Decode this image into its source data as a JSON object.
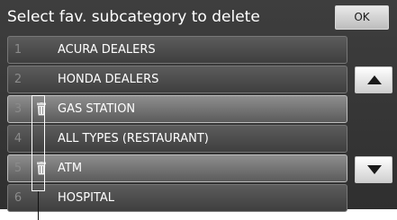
{
  "header": {
    "title": "Select fav. subcategory to delete",
    "ok_label": "OK"
  },
  "list": {
    "items": [
      {
        "number": "1",
        "label": "ACURA DEALERS",
        "selected": false,
        "trash_icon": false
      },
      {
        "number": "2",
        "label": "HONDA DEALERS",
        "selected": false,
        "trash_icon": false
      },
      {
        "number": "3",
        "label": "GAS STATION",
        "selected": true,
        "trash_icon": true
      },
      {
        "number": "4",
        "label": "ALL TYPES (RESTAURANT)",
        "selected": false,
        "trash_icon": false
      },
      {
        "number": "5",
        "label": "ATM",
        "selected": true,
        "trash_icon": true
      },
      {
        "number": "6",
        "label": "HOSPITAL",
        "selected": false,
        "trash_icon": false
      }
    ]
  },
  "scroll": {
    "up_icon": "triangle-up-icon",
    "down_icon": "triangle-down-icon"
  },
  "colors": {
    "screen_background": "#363636",
    "row_background": "#4d4d4d",
    "row_selected_background": "#747474",
    "text": "#ffffff",
    "row_number_text": "#8b8b8b"
  }
}
